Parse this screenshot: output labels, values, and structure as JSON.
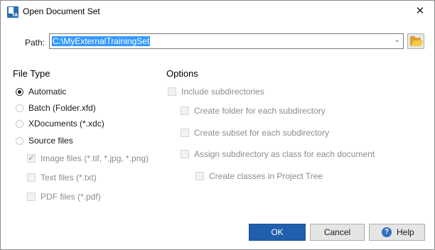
{
  "window": {
    "title": "Open Document Set",
    "app_icon": "training-app-icon",
    "app_icon_text": "TA",
    "close_glyph": "✕"
  },
  "path": {
    "label": "Path:",
    "value": "C:\\MyExternalTrainingSet",
    "dropdown_glyph": "⌄",
    "browse_icon": "folder-open-icon"
  },
  "file_type": {
    "heading": "File Type",
    "options": [
      {
        "label": "Automatic",
        "selected": true
      },
      {
        "label": "Batch (Folder.xfd)",
        "selected": false
      },
      {
        "label": "XDocuments (*.xdc)",
        "selected": false
      },
      {
        "label": "Source files",
        "selected": false
      }
    ],
    "source_files": [
      {
        "label": "Image files (*.tif, *.jpg, *.png)",
        "checked": true,
        "enabled": false
      },
      {
        "label": "Text files (*.txt)",
        "checked": false,
        "enabled": false
      },
      {
        "label": "PDF files (*.pdf)",
        "checked": false,
        "enabled": false
      }
    ]
  },
  "options": {
    "heading": "Options",
    "items": [
      {
        "label": "Include subdirectories",
        "checked": false,
        "enabled": false
      },
      {
        "label": "Create folder for each subdirectory",
        "checked": false,
        "enabled": false
      },
      {
        "label": "Create subset for each subdirectory",
        "checked": false,
        "enabled": false
      },
      {
        "label": "Assign subdirectory as class for each document",
        "checked": false,
        "enabled": false
      },
      {
        "label": "Create classes in Project Tree",
        "checked": false,
        "enabled": false
      }
    ]
  },
  "buttons": {
    "ok": "OK",
    "cancel": "Cancel",
    "help": "Help",
    "help_icon_glyph": "?"
  },
  "colors": {
    "primary_button": "#1f5fae",
    "selection": "#3399ff",
    "disabled_text": "#8c8c8c"
  }
}
